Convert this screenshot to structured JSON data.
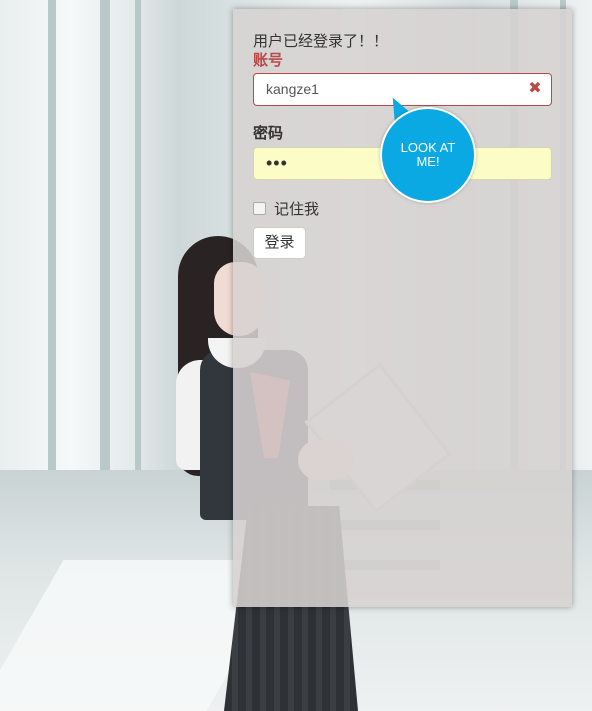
{
  "login_form": {
    "status_message": "用户已经登录了！！",
    "account_label": "账号",
    "account_value": "kangze1",
    "clear_icon": "✖",
    "password_label": "密码",
    "password_masked": "•••",
    "remember_label": "记住我",
    "login_button": "登录"
  },
  "tooltip": {
    "text": "LOOK AT ME!"
  },
  "colors": {
    "error_red": "#b94a48",
    "bubble_blue": "#0ba9e3",
    "password_bg": "#fcfcc6"
  }
}
